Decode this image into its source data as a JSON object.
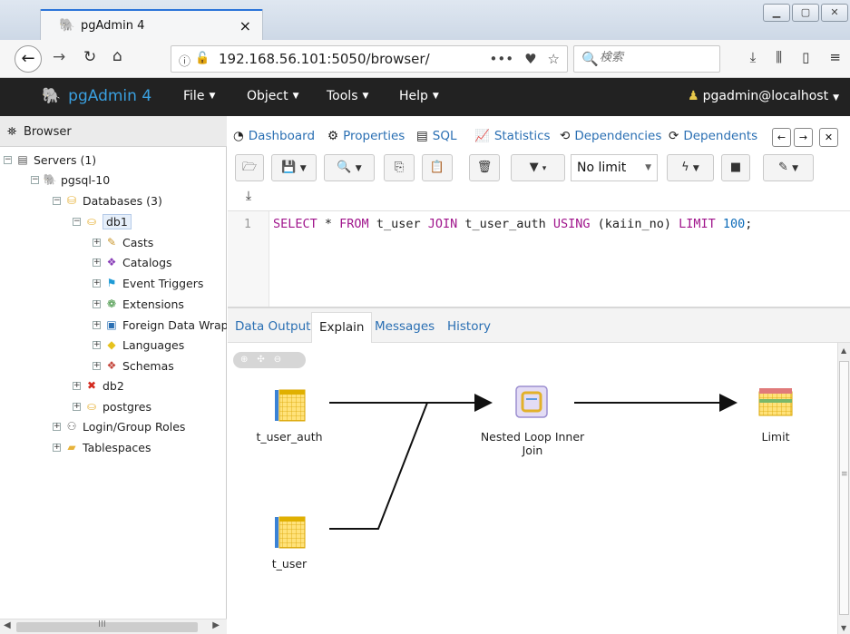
{
  "browser": {
    "tab_title": "pgAdmin 4",
    "tab_close": "×",
    "url": "192.168.56.101:5050/browser/",
    "url_menu": "•••",
    "search_placeholder": "検索",
    "window_buttons": [
      "▁",
      "▢",
      "✕"
    ]
  },
  "menubar": {
    "brand": "pgAdmin 4",
    "items": [
      {
        "label": "File"
      },
      {
        "label": "Object"
      },
      {
        "label": "Tools"
      },
      {
        "label": "Help"
      }
    ],
    "user": "pgadmin@localhost"
  },
  "browser_panel": {
    "title": "Browser",
    "tree": [
      {
        "label": "Servers (1)"
      },
      {
        "label": "pgsql-10"
      },
      {
        "label": "Databases (3)"
      },
      {
        "label": "db1"
      },
      {
        "label": "Casts"
      },
      {
        "label": "Catalogs"
      },
      {
        "label": "Event Triggers"
      },
      {
        "label": "Extensions"
      },
      {
        "label": "Foreign Data Wrapp"
      },
      {
        "label": "Languages"
      },
      {
        "label": "Schemas"
      },
      {
        "label": "db2"
      },
      {
        "label": "postgres"
      },
      {
        "label": "Login/Group Roles"
      },
      {
        "label": "Tablespaces"
      }
    ],
    "scroll_grip": "III"
  },
  "main_tabs": [
    {
      "label": "Dashboard",
      "icon": "dashboard-icon"
    },
    {
      "label": "Properties",
      "icon": "cogs-icon"
    },
    {
      "label": "SQL",
      "icon": "file-icon"
    },
    {
      "label": "Statistics",
      "icon": "chart-icon"
    },
    {
      "label": "Dependencies",
      "icon": "dependencies-icon"
    },
    {
      "label": "Dependents",
      "icon": "dependents-icon"
    }
  ],
  "query_toolbar": {
    "limit": "No limit"
  },
  "editor": {
    "line_number": "1",
    "tokens": [
      {
        "t": "SELECT",
        "k": "kw"
      },
      {
        "t": " * ",
        "k": ""
      },
      {
        "t": "FROM",
        "k": "kw"
      },
      {
        "t": " t_user ",
        "k": ""
      },
      {
        "t": "JOIN",
        "k": "kw"
      },
      {
        "t": " t_user_auth ",
        "k": ""
      },
      {
        "t": "USING",
        "k": "kw"
      },
      {
        "t": " (kaiin_no) ",
        "k": ""
      },
      {
        "t": "LIMIT",
        "k": "kw"
      },
      {
        "t": " ",
        "k": ""
      },
      {
        "t": "100",
        "k": "num"
      },
      {
        "t": ";",
        "k": ""
      }
    ]
  },
  "result_tabs": [
    {
      "label": "Data Output",
      "active": false
    },
    {
      "label": "Explain",
      "active": true
    },
    {
      "label": "Messages",
      "active": false
    },
    {
      "label": "History",
      "active": false
    }
  ],
  "explain_plan": {
    "nodes": [
      {
        "id": "t_user_auth",
        "label": "t_user_auth"
      },
      {
        "id": "t_user",
        "label": "t_user"
      },
      {
        "id": "nested_loop",
        "label": "Nested Loop Inner Join"
      },
      {
        "id": "limit",
        "label": "Limit"
      }
    ]
  },
  "colors": {
    "menubar_bg": "#222222",
    "brand": "#3aa0e0",
    "link": "#2a6fb3",
    "sql_keyword": "#a0158c",
    "sql_number": "#0b6ab8"
  }
}
